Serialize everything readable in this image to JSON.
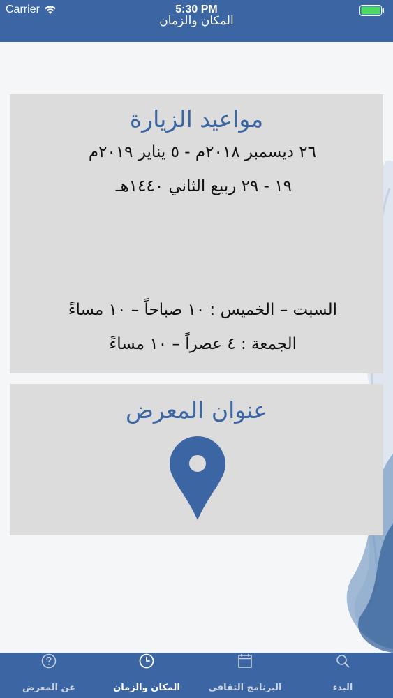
{
  "status_bar": {
    "carrier": "Carrier",
    "time": "5:30 PM"
  },
  "nav": {
    "title": "المكان والزمان"
  },
  "visits_card": {
    "title": "مواعيد الزيارة",
    "gregorian_dates": "٢٦ ديسمبر ٢٠١٨م - ٥ يناير ٢٠١٩م",
    "hijri_dates": "١٩ - ٢٩ ربيع الثاني ١٤٤٠هـ",
    "weekday_hours": "السبت – الخميس : ١٠ صباحاً – ١٠ مساءً",
    "friday_hours": "الجمعة : ٤ عصراً – ١٠ مساءً"
  },
  "address_card": {
    "title": "عنوان المعرض",
    "pin_icon": "location-pin-icon"
  },
  "tabs": [
    {
      "label": "عن المعرض",
      "icon": "question-circle-icon",
      "active": false
    },
    {
      "label": "المكان والزمان",
      "icon": "clock-icon",
      "active": true
    },
    {
      "label": "البرنامج الثقافي",
      "icon": "calendar-icon",
      "active": false
    },
    {
      "label": "البدء",
      "icon": "search-icon",
      "active": false
    }
  ],
  "colors": {
    "primary": "#3b66a3",
    "card_bg": "#dcdcdc",
    "background": "#f5f6f8"
  }
}
